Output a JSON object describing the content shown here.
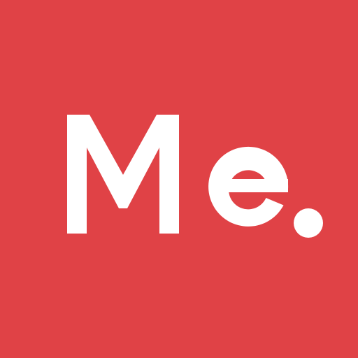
{
  "app_icon": {
    "logo_text": "Me.",
    "background_color": "#E04246",
    "text_color": "#FFFFFF"
  }
}
